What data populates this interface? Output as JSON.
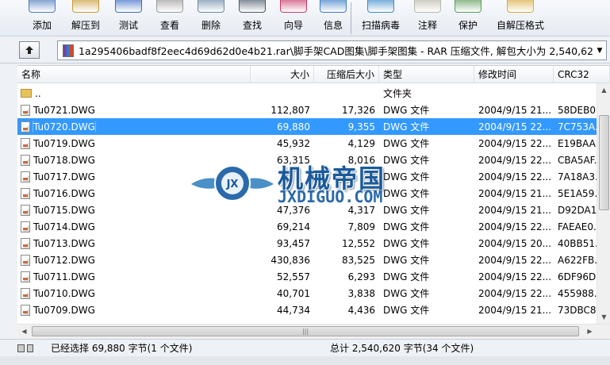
{
  "toolbar": {
    "buttons": [
      {
        "label": "添加",
        "icon": "add-books-icon",
        "color": "#4a7ab8"
      },
      {
        "label": "解压到",
        "icon": "extract-folder-icon",
        "color": "#c89a3a"
      },
      {
        "label": "测试",
        "icon": "test-check-icon",
        "color": "#3a6ac8"
      },
      {
        "label": "查看",
        "icon": "view-book-icon",
        "color": "#9a9a9a"
      },
      {
        "label": "删除",
        "icon": "delete-icon",
        "color": "#6a8aa8"
      },
      {
        "label": "查找",
        "icon": "find-binoculars-icon",
        "color": "#4a5a6a"
      },
      {
        "label": "向导",
        "icon": "wizard-icon",
        "color": "#c83a6a"
      },
      {
        "label": "信息",
        "icon": "info-icon",
        "color": "#3a7ac8"
      },
      {
        "label": "扫描病毒",
        "icon": "virus-scan-icon",
        "color": "#3a8ac8"
      },
      {
        "label": "注释",
        "icon": "comment-icon",
        "color": "#b8b8a8"
      },
      {
        "label": "保护",
        "icon": "protect-shield-icon",
        "color": "#5a9a5a"
      },
      {
        "label": "自解压格式",
        "icon": "sfx-icon",
        "color": "#d8a83a"
      }
    ]
  },
  "pathbar": {
    "path": "1a295406badf8f2eec4d69d62d0e4b21.rar\\脚手架CAD图集\\脚手架图集 - RAR 压缩文件, 解包大小为 2,540,620 字节"
  },
  "columns": {
    "name": "名称",
    "size": "大小",
    "packed": "压缩后大小",
    "type": "类型",
    "modified": "修改时间",
    "crc": "CRC32"
  },
  "rows": [
    {
      "name": "..",
      "size": "",
      "packed": "",
      "type": "文件夹",
      "modified": "",
      "crc": "",
      "folder": true
    },
    {
      "name": "Tu0721.DWG",
      "size": "112,807",
      "packed": "17,326",
      "type": "DWG 文件",
      "modified": "2004/9/15 21...",
      "crc": "58DEB0..."
    },
    {
      "name": "Tu0720.DWG",
      "size": "69,880",
      "packed": "9,355",
      "type": "DWG 文件",
      "modified": "2004/9/15 22...",
      "crc": "7C753A...",
      "selected": true
    },
    {
      "name": "Tu0719.DWG",
      "size": "45,932",
      "packed": "4,129",
      "type": "DWG 文件",
      "modified": "2004/9/15 22...",
      "crc": "E19BAA..."
    },
    {
      "name": "Tu0718.DWG",
      "size": "63,315",
      "packed": "8,016",
      "type": "DWG 文件",
      "modified": "2004/9/15 22...",
      "crc": "CBA5AF..."
    },
    {
      "name": "Tu0717.DWG",
      "size": "",
      "packed": "",
      "type": "DWG 文件",
      "modified": "2004/9/15 22...",
      "crc": "7A18A3..."
    },
    {
      "name": "Tu0716.DWG",
      "size": "",
      "packed": "",
      "type": "DWG 文件",
      "modified": "2004/9/15 21...",
      "crc": "5E1A59..."
    },
    {
      "name": "Tu0715.DWG",
      "size": "47,376",
      "packed": "4,317",
      "type": "DWG 文件",
      "modified": "2004/9/15 21...",
      "crc": "D92DA1..."
    },
    {
      "name": "Tu0714.DWG",
      "size": "69,214",
      "packed": "7,809",
      "type": "DWG 文件",
      "modified": "2004/9/15 22...",
      "crc": "FAEAE0..."
    },
    {
      "name": "Tu0713.DWG",
      "size": "93,457",
      "packed": "12,552",
      "type": "DWG 文件",
      "modified": "2004/9/15 20...",
      "crc": "40BB51..."
    },
    {
      "name": "Tu0712.DWG",
      "size": "430,836",
      "packed": "83,525",
      "type": "DWG 文件",
      "modified": "2004/9/15 22...",
      "crc": "A622FB..."
    },
    {
      "name": "Tu0711.DWG",
      "size": "52,557",
      "packed": "6,293",
      "type": "DWG 文件",
      "modified": "2004/9/15 22...",
      "crc": "6DF96D..."
    },
    {
      "name": "Tu0710.DWG",
      "size": "40,701",
      "packed": "3,838",
      "type": "DWG 文件",
      "modified": "2004/9/15 22...",
      "crc": "455988..."
    },
    {
      "name": "Tu0709.DWG",
      "size": "44,734",
      "packed": "4,436",
      "type": "DWG 文件",
      "modified": "2004/9/15 21...",
      "crc": "73DBC8..."
    }
  ],
  "status": {
    "left": "已经选择 69,880 字节(1 个文件)",
    "right": "总计 2,540,620 字节(34 个文件)"
  },
  "watermark": {
    "title": "机械帝国",
    "subtitle": "JXDIGUO.COM",
    "badge": "JX"
  }
}
